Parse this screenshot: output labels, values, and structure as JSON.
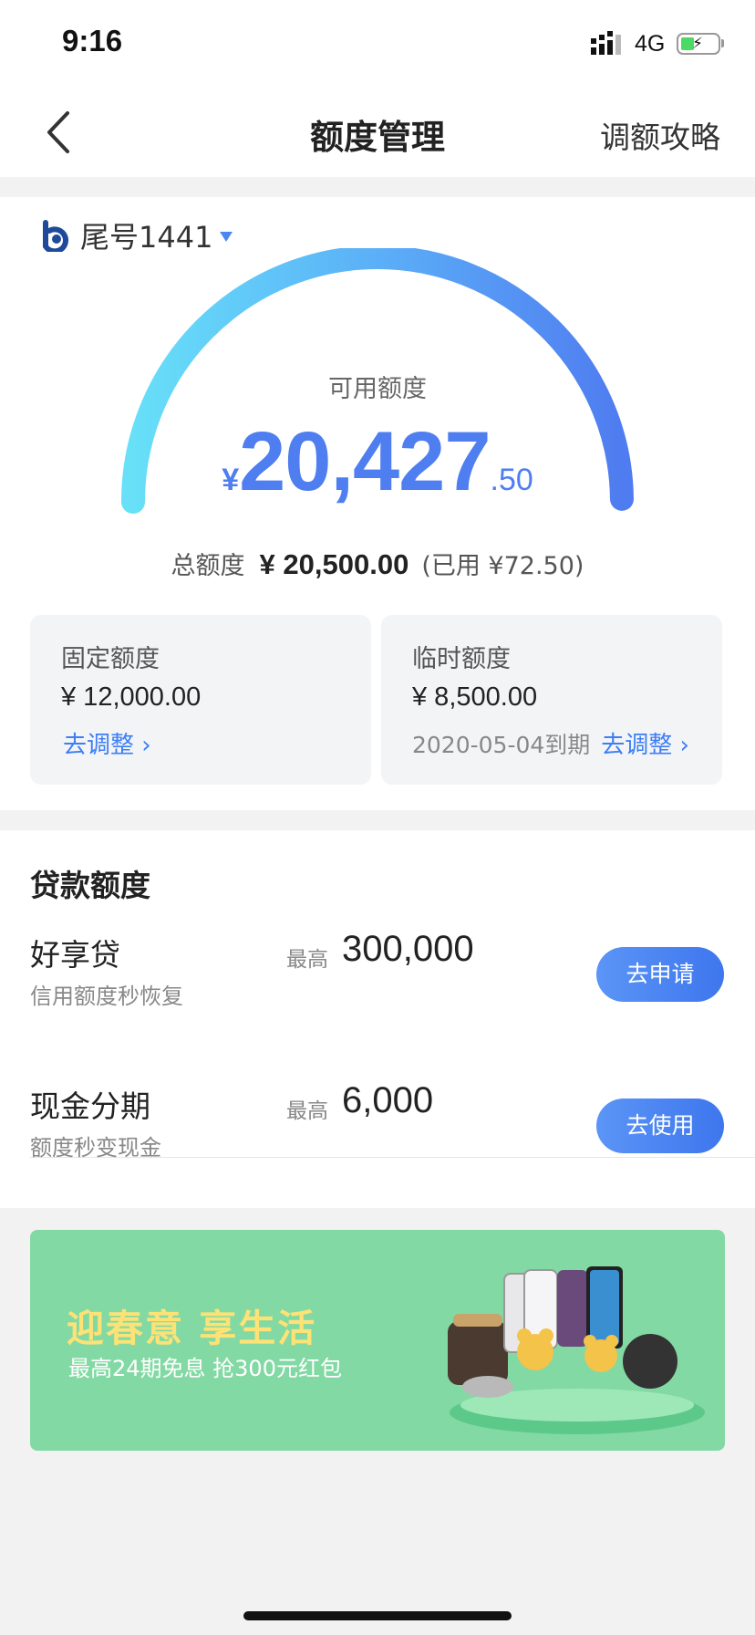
{
  "status_bar": {
    "time": "9:16",
    "network": "4G"
  },
  "nav": {
    "title": "额度管理",
    "right_link": "调额攻略"
  },
  "account": {
    "label": "尾号1441"
  },
  "gauge": {
    "label": "可用额度",
    "currency": "¥",
    "amount_int": "20,427",
    "amount_dec": ".50",
    "available_fraction": 0.996
  },
  "total": {
    "label": "总额度",
    "value": "¥ 20,500.00",
    "used": "(已用 ¥72.50)"
  },
  "fixed": {
    "title": "固定额度",
    "amount": "¥ 12,000.00",
    "link": "去调整 ›"
  },
  "temporary": {
    "title": "临时额度",
    "amount": "¥ 8,500.00",
    "expiry": "2020-05-04到期",
    "link": "去调整 ›"
  },
  "loans": {
    "title": "贷款额度",
    "items": [
      {
        "name": "好享贷",
        "desc": "信用额度秒恢复",
        "max_label": "最高",
        "max_value": "300,000",
        "button": "去申请"
      },
      {
        "name": "现金分期",
        "desc": "额度秒变现金",
        "max_label": "最高",
        "max_value": "6,000",
        "button": "去使用"
      }
    ]
  },
  "banner": {
    "title": "迎春意 享生活",
    "subtitle": "最高24期免息 抢300元红包"
  },
  "colors": {
    "accent": "#4e7ef0",
    "link": "#3d7ef5",
    "banner_bg": "#82d9a3",
    "banner_title": "#fde276"
  }
}
